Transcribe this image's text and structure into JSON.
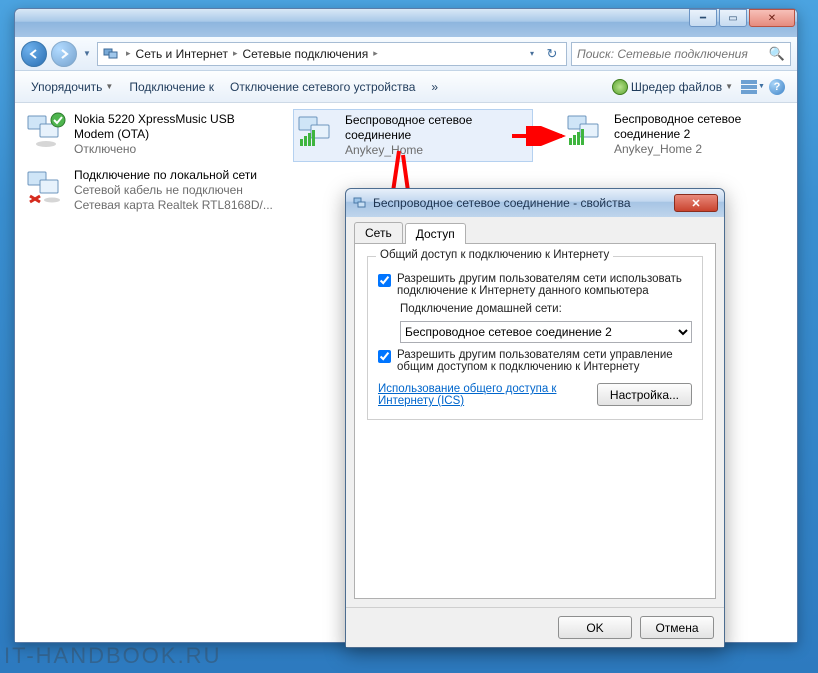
{
  "breadcrumbs": {
    "parts": [
      "Сеть и Интернет",
      "Сетевые подключения"
    ]
  },
  "search": {
    "placeholder": "Поиск: Сетевые подключения"
  },
  "toolbar": {
    "organize": "Упорядочить",
    "connect_to": "Подключение к",
    "disable_device": "Отключение сетевого устройства",
    "extra": "»",
    "shredder": "Шредер файлов"
  },
  "connections": {
    "usb_modem": {
      "line1": "Nokia 5220 XpressMusic USB",
      "line2": "Modem (OTA)",
      "line3": "Отключено"
    },
    "wlan1": {
      "line1": "Беспроводное сетевое",
      "line2": "соединение",
      "line3": "Anykey_Home"
    },
    "wlan2": {
      "line1": "Беспроводное сетевое",
      "line2": "соединение 2",
      "line3": "Anykey_Home 2"
    },
    "lan": {
      "line1": "Подключение по локальной сети",
      "line2": "Сетевой кабель не подключен",
      "line3": "Сетевая карта Realtek RTL8168D/..."
    }
  },
  "dialog": {
    "title": "Беспроводное сетевое соединение - свойства",
    "tabs": {
      "network": "Сеть",
      "sharing": "Доступ"
    },
    "group_label": "Общий доступ к подключению к Интернету",
    "allow_share": "Разрешить другим пользователям сети использовать подключение к Интернету данного компьютера",
    "home_net_label": "Подключение домашней сети:",
    "home_net_value": "Беспроводное сетевое соединение 2",
    "allow_control": "Разрешить другим пользователям сети управление общим доступом к подключению к Интернету",
    "ics_link": "Использование общего доступа к Интернету (ICS)",
    "settings_btn": "Настройка...",
    "ok": "OK",
    "cancel": "Отмена"
  },
  "watermark": "IT-HANDBOOK.RU"
}
